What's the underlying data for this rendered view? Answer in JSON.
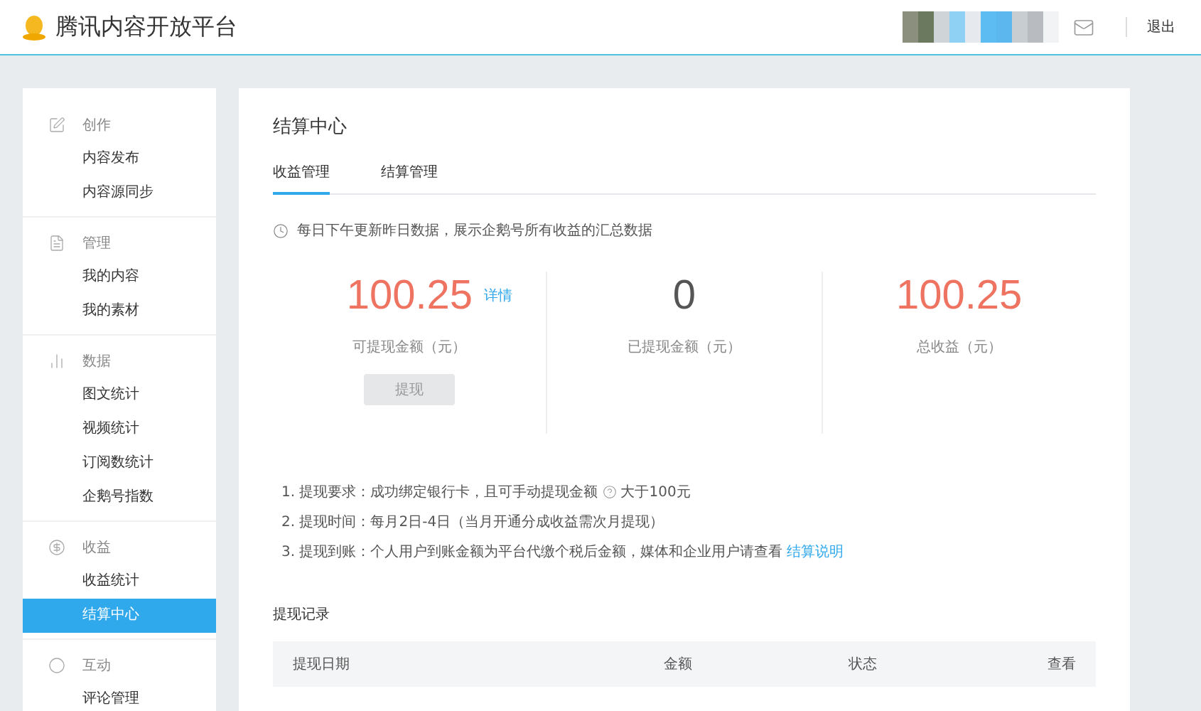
{
  "header": {
    "logo_text": "腾讯内容开放平台",
    "logout": "退出"
  },
  "sidebar": {
    "groups": [
      {
        "title": "创作",
        "items": [
          {
            "label": "内容发布",
            "selected": false
          },
          {
            "label": "内容源同步",
            "selected": false
          }
        ]
      },
      {
        "title": "管理",
        "items": [
          {
            "label": "我的内容",
            "selected": false
          },
          {
            "label": "我的素材",
            "selected": false
          }
        ]
      },
      {
        "title": "数据",
        "items": [
          {
            "label": "图文统计",
            "selected": false
          },
          {
            "label": "视频统计",
            "selected": false
          },
          {
            "label": "订阅数统计",
            "selected": false
          },
          {
            "label": "企鹅号指数",
            "selected": false
          }
        ]
      },
      {
        "title": "收益",
        "items": [
          {
            "label": "收益统计",
            "selected": false
          },
          {
            "label": "结算中心",
            "selected": true
          }
        ]
      },
      {
        "title": "互动",
        "items": [
          {
            "label": "评论管理",
            "selected": false
          }
        ]
      }
    ]
  },
  "main": {
    "title": "结算中心",
    "tabs": [
      {
        "label": "收益管理",
        "selected": true
      },
      {
        "label": "结算管理",
        "selected": false
      }
    ],
    "notice": "每日下午更新昨日数据，展示企鹅号所有收益的汇总数据",
    "stats": [
      {
        "value": "100.25",
        "label": "可提现金额（元）",
        "link": "详情",
        "button": {
          "label": "提现",
          "disabled": true
        },
        "color": "#ee7361"
      },
      {
        "value": "0",
        "label": "已提现金额（元）",
        "color": "#555555"
      },
      {
        "value": "100.25",
        "label": "总收益（元）",
        "color": "#ee7361"
      }
    ],
    "rules": [
      {
        "kind": "help",
        "text": "1. 提现要求：成功绑定银行卡，且可手动提现金额",
        "after": "大于100元"
      },
      {
        "kind": "plain",
        "text": "2. 提现时间：每月2日-4日（当月开通分成收益需次月提现）"
      },
      {
        "kind": "link",
        "text": "3. 提现到账：个人用户到账金额为平台代缴个税后金额，媒体和企业用户请查看",
        "link": "结算说明"
      }
    ],
    "records": {
      "title": "提现记录",
      "columns": [
        "提现日期",
        "金额",
        "状态",
        "查看"
      ]
    }
  }
}
